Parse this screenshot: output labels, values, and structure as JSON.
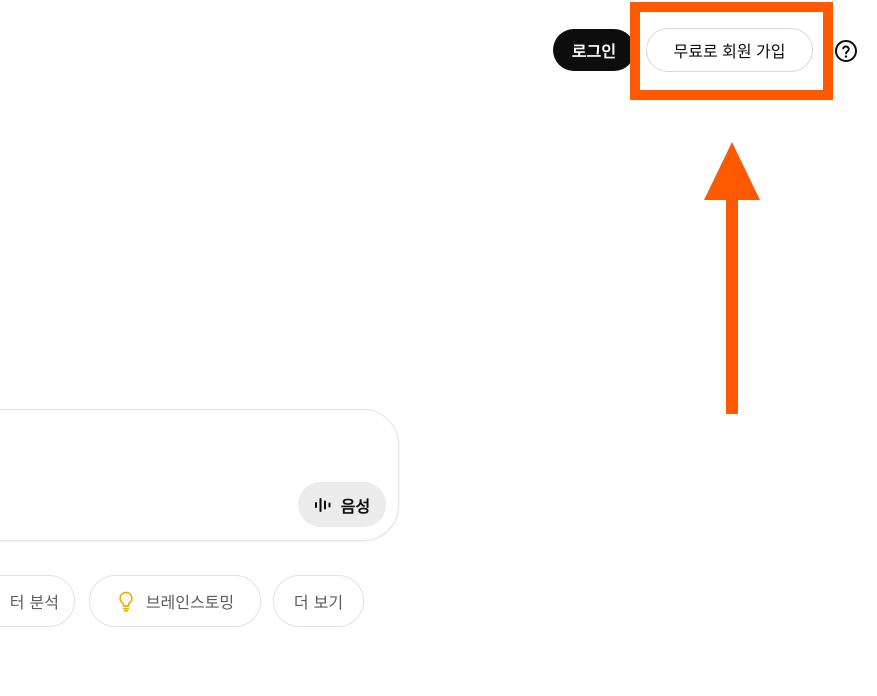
{
  "header": {
    "login_label": "로그인",
    "signup_label": "무료로 회원 가입",
    "help_icon": "question-circle-icon"
  },
  "composer": {
    "voice_label": "음성",
    "voice_icon": "waveform-icon"
  },
  "suggestions": [
    {
      "label": "터 분석"
    },
    {
      "label": "브레인스토밍",
      "icon": "lightbulb-icon"
    },
    {
      "label": "더 보기"
    }
  ],
  "colors": {
    "annotation": "#ff5a00",
    "login_bg": "#0d0d0d",
    "voice_bg": "#ececec",
    "bulb": "#e8b100"
  }
}
